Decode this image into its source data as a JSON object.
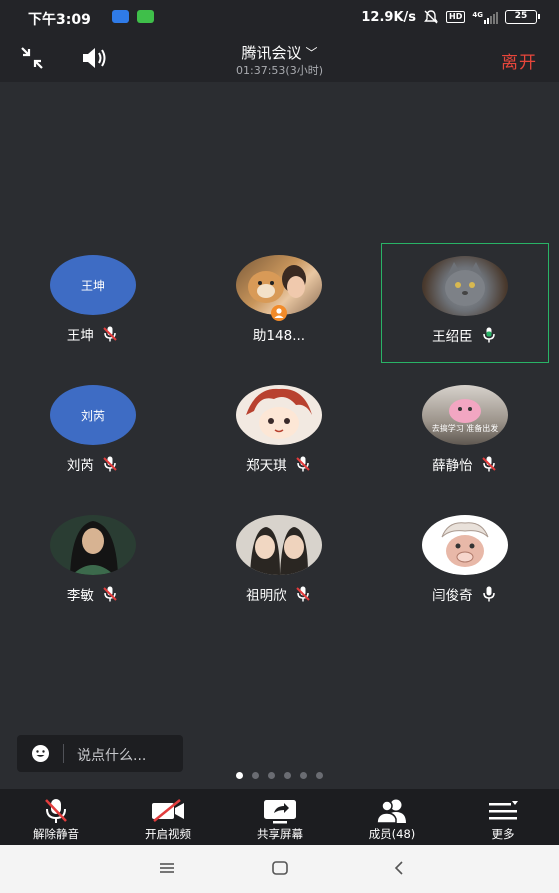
{
  "status_bar": {
    "time": "下午3:09",
    "network_speed": "12.9K/s",
    "hd_badge": "HD",
    "signal_label": "4G",
    "battery": "25"
  },
  "header": {
    "title": "腾讯会议",
    "duration": "01:37:53(3小时)",
    "leave_label": "离开"
  },
  "participants": [
    {
      "name": "王坤",
      "avatar_text": "王坤",
      "mic": "muted"
    },
    {
      "name": "助148...",
      "mic": "none",
      "host": true
    },
    {
      "name": "王绍臣",
      "mic": "speaking",
      "active": true
    },
    {
      "name": "刘芮",
      "avatar_text": "刘芮",
      "mic": "muted"
    },
    {
      "name": "郑天琪",
      "mic": "muted"
    },
    {
      "name": "薛静怡",
      "avatar_text": "去搞学习 准备出发",
      "mic": "muted"
    },
    {
      "name": "李敏",
      "mic": "muted"
    },
    {
      "name": "祖明欣",
      "mic": "muted"
    },
    {
      "name": "闫俊奇",
      "mic": "on"
    }
  ],
  "chat": {
    "placeholder": "说点什么..."
  },
  "pager": {
    "pages": 6,
    "current": 1
  },
  "toolbar": {
    "unmute": "解除静音",
    "video": "开启视频",
    "share": "共享屏幕",
    "members": "成员(48)",
    "more": "更多"
  },
  "colors": {
    "background": "#2b2d31",
    "bar": "#232428",
    "leave": "#e7463b",
    "active_border": "#29b366",
    "muted_red": "#e23d3d",
    "avatar_blue": "#3e6cc4"
  }
}
